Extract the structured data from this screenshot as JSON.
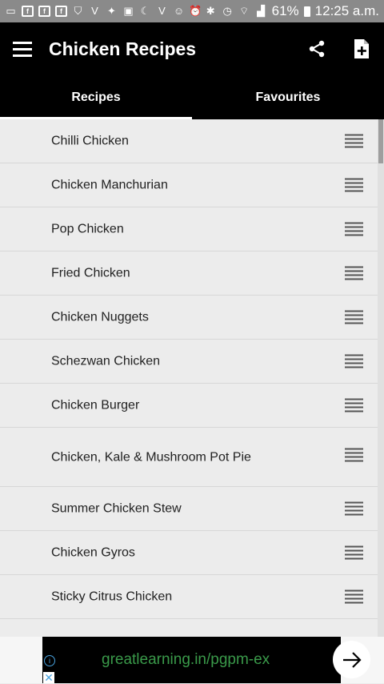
{
  "status_bar": {
    "battery": "61%",
    "time": "12:25 a.m.",
    "icons": [
      "message-icon",
      "facebook-icon",
      "facebook-icon",
      "facebook-icon",
      "shield-icon",
      "v-icon",
      "twitter-icon",
      "gallery-icon",
      "moon-icon",
      "v-icon",
      "smiley-icon",
      "alarm-icon",
      "bluetooth-icon",
      "alarm-icon",
      "wifi-icon",
      "signal-icon",
      "battery-icon"
    ]
  },
  "app_bar": {
    "title": "Chicken Recipes",
    "icons": [
      "menu-icon",
      "share-icon",
      "add-document-icon"
    ]
  },
  "tabs": [
    {
      "label": "Recipes",
      "active": true
    },
    {
      "label": "Favourites",
      "active": false
    }
  ],
  "recipes": [
    "Chilli Chicken",
    "Chicken Manchurian",
    "Pop Chicken",
    "Fried Chicken",
    "Chicken Nuggets",
    "Schezwan Chicken",
    "Chicken Burger",
    "Chicken, Kale & Mushroom Pot Pie",
    "Summer Chicken Stew",
    "Chicken Gyros",
    "Sticky Citrus Chicken"
  ],
  "ad": {
    "text": "greatlearning.in/pgpm-ex",
    "accent": "#3a9a4a"
  },
  "colors": {
    "app_bar": "#000000",
    "status_bar": "#8a8a8a",
    "list_background": "#ececec"
  }
}
